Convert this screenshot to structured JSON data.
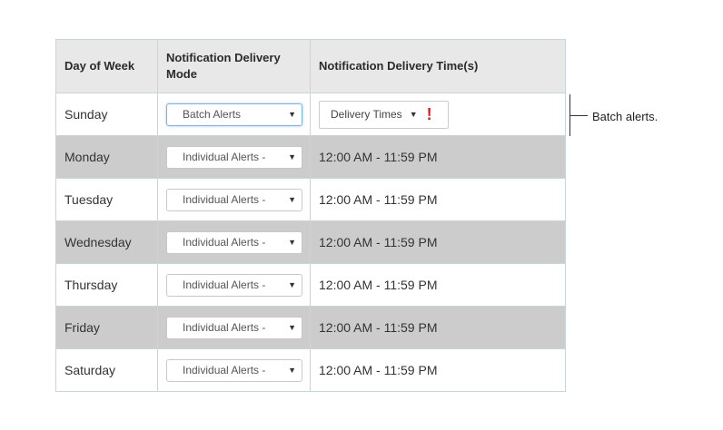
{
  "table": {
    "headers": [
      "Day of Week",
      "Notification Delivery Mode",
      "Notification Delivery Time(s)"
    ],
    "rows": [
      {
        "day": "Sunday",
        "mode": "Batch Alerts",
        "delivery_button": "Delivery Times"
      },
      {
        "day": "Monday",
        "mode": "Individual Alerts -",
        "time": "12:00 AM - 11:59 PM"
      },
      {
        "day": "Tuesday",
        "mode": "Individual Alerts -",
        "time": "12:00 AM - 11:59 PM"
      },
      {
        "day": "Wednesday",
        "mode": "Individual Alerts -",
        "time": "12:00 AM - 11:59 PM"
      },
      {
        "day": "Thursday",
        "mode": "Individual Alerts -",
        "time": "12:00 AM - 11:59 PM"
      },
      {
        "day": "Friday",
        "mode": "Individual Alerts -",
        "time": "12:00 AM - 11:59 PM"
      },
      {
        "day": "Saturday",
        "mode": "Individual Alerts -",
        "time": "12:00 AM - 11:59 PM"
      }
    ]
  },
  "warning_symbol": "!",
  "annotation": "Batch alerts.",
  "icons": {
    "caret": "caret-down-icon",
    "warning": "exclamation-icon"
  },
  "colors": {
    "shaded_row": "#cccccc",
    "header_bg": "#e8e8e8",
    "warning": "#e8161c",
    "focus_border": "#7fb2dd"
  }
}
